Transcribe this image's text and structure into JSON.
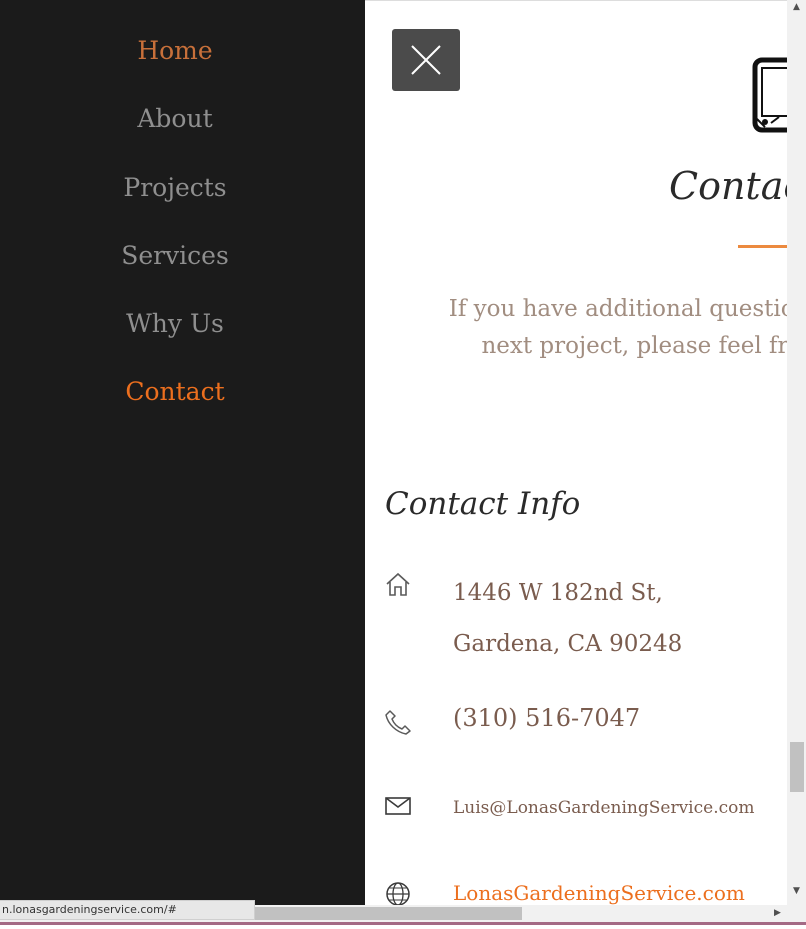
{
  "sidebar": {
    "items": [
      {
        "label": "Home"
      },
      {
        "label": "About"
      },
      {
        "label": "Projects"
      },
      {
        "label": "Services"
      },
      {
        "label": "Why Us"
      },
      {
        "label": "Contact"
      }
    ]
  },
  "main": {
    "heading": "Contac",
    "intro_line1": "If you have additional questions",
    "intro_line2": "next project, please feel fr",
    "contact_info": {
      "title": "Contact Info",
      "address_line1": "1446 W 182nd St,",
      "address_line2": "Gardena, CA 90248",
      "phone": "(310) 516-7047",
      "email": "Luis@LonasGardeningService.com",
      "website": "LonasGardeningService.com"
    }
  },
  "status_bar": {
    "url": "n.lonasgardeningservice.com/#"
  },
  "colors": {
    "sidebar_bg": "#1b1b1b",
    "accent": "#ec6f1e",
    "muted_text": "#a18d80"
  }
}
